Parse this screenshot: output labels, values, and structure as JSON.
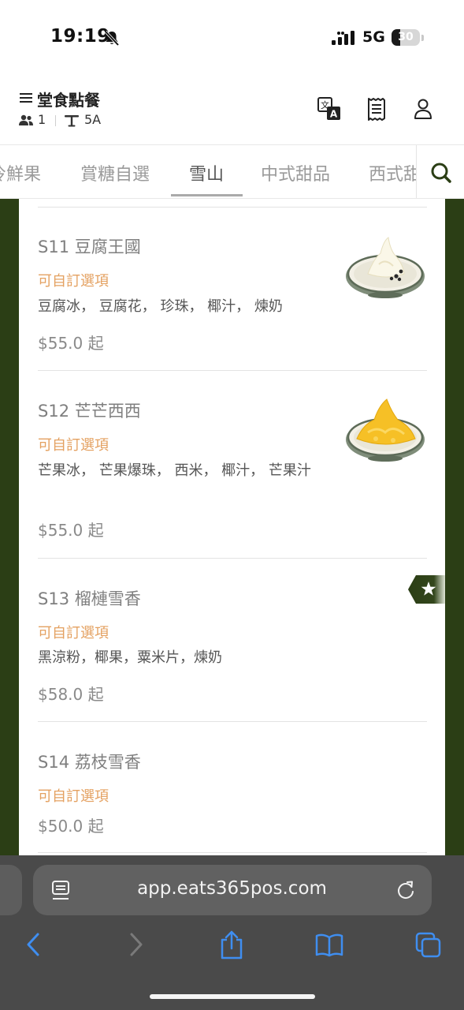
{
  "status_bar": {
    "time": "19:19",
    "network": "5G",
    "battery_level": "30",
    "battery_fraction": 0.3
  },
  "header": {
    "title": "堂食點餐",
    "guest_count": "1",
    "table_number": "5A"
  },
  "tabs": [
    {
      "label": "冷鮮果"
    },
    {
      "label": "賞糖自選"
    },
    {
      "label": "雪山",
      "active": true
    },
    {
      "label": "中式甜品"
    },
    {
      "label": "西式甜"
    }
  ],
  "menu_items": [
    {
      "name": "S11 豆腐王國",
      "customizable": "可自訂選項",
      "description": "豆腐冰， 豆腐花， 珍珠， 椰汁， 煉奶",
      "price": "$55.0 起",
      "image": "tofu-shaved-ice-image"
    },
    {
      "name": "S12 芒芒西西",
      "customizable": "可自訂選項",
      "description": "芒果冰， 芒果爆珠， 西米， 椰汁， 芒果汁",
      "price": "$55.0 起",
      "image": "mango-shaved-ice-image"
    },
    {
      "name": "S13 榴槤雪香",
      "customizable": "可自訂選項",
      "description": "黑涼粉，椰果，粟米片，煉奶",
      "price": "$58.0 起",
      "featured": true
    },
    {
      "name": "S14 荔枝雪香",
      "customizable": "可自訂選項",
      "price": "$50.0 起"
    }
  ],
  "browser": {
    "url": "app.eats365pos.com"
  },
  "colors": {
    "accent_green": "#2b3e15",
    "customizable_orange": "#e4a161"
  }
}
